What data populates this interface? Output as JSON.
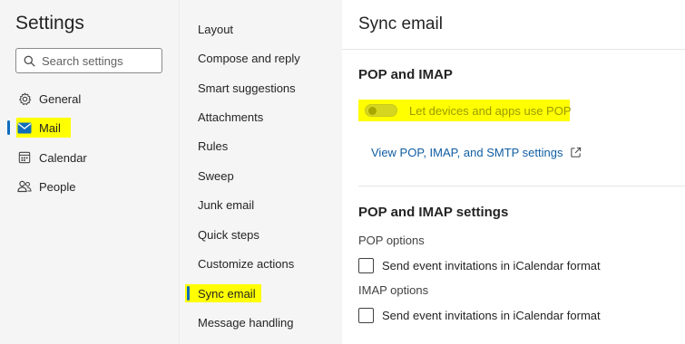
{
  "sidebar": {
    "title": "Settings",
    "search_placeholder": "Search settings",
    "items": [
      {
        "label": "General",
        "icon": "gear-icon"
      },
      {
        "label": "Mail",
        "icon": "mail-icon"
      },
      {
        "label": "Calendar",
        "icon": "calendar-icon"
      },
      {
        "label": "People",
        "icon": "people-icon"
      }
    ]
  },
  "subnav": {
    "items": [
      "Layout",
      "Compose and reply",
      "Smart suggestions",
      "Attachments",
      "Rules",
      "Sweep",
      "Junk email",
      "Quick steps",
      "Customize actions",
      "Sync email",
      "Message handling"
    ]
  },
  "main": {
    "title": "Sync email",
    "pop_imap_heading": "POP and IMAP",
    "toggle_label": "Let devices and apps use POP",
    "toggle_on": false,
    "link_label": "View POP, IMAP, and SMTP settings",
    "settings_heading": "POP and IMAP settings",
    "pop_options_label": "POP options",
    "pop_checkbox_label": "Send event invitations in iCalendar format",
    "imap_options_label": "IMAP options",
    "imap_checkbox_label": "Send event invitations in iCalendar format"
  },
  "colors": {
    "accent": "#0f6cbd",
    "highlight": "#ffff00",
    "link": "#115ea3"
  }
}
